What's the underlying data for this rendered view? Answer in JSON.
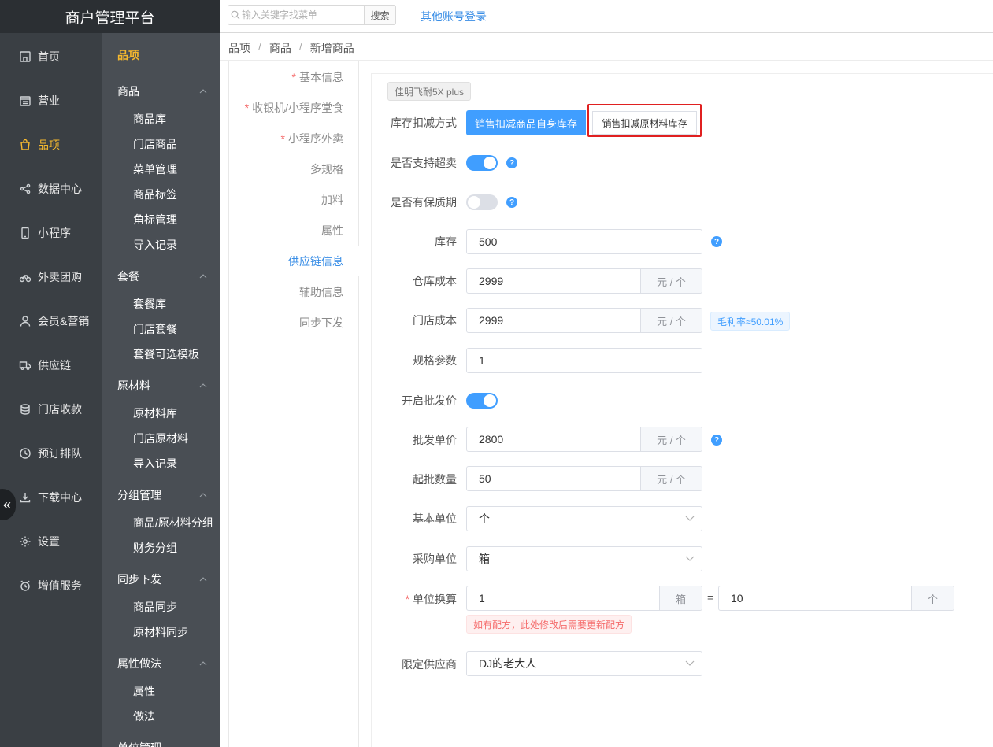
{
  "app": {
    "brand": "商户管理平台"
  },
  "leftnav": {
    "items": [
      {
        "label": "首页",
        "icon": "home-icon",
        "active": false
      },
      {
        "label": "营业",
        "icon": "calendar-icon",
        "active": false
      },
      {
        "label": "品项",
        "icon": "bag-icon",
        "active": true
      },
      {
        "label": "数据中心",
        "icon": "share-icon",
        "active": false
      },
      {
        "label": "小程序",
        "icon": "phone-icon",
        "active": false
      },
      {
        "label": "外卖团购",
        "icon": "bike-icon",
        "active": false
      },
      {
        "label": "会员&营销",
        "icon": "user-icon",
        "active": false
      },
      {
        "label": "供应链",
        "icon": "truck-icon",
        "active": false
      },
      {
        "label": "门店收款",
        "icon": "coins-icon",
        "active": false
      },
      {
        "label": "预订排队",
        "icon": "clock-icon",
        "active": false
      },
      {
        "label": "下载中心",
        "icon": "download-icon",
        "active": false
      },
      {
        "label": "设置",
        "icon": "gear-icon",
        "active": false
      },
      {
        "label": "增值服务",
        "icon": "alarm-icon",
        "active": false
      }
    ],
    "collapse_glyph": "«"
  },
  "subnav": {
    "title": "品项",
    "groups": [
      {
        "label": "商品",
        "items": [
          "商品库",
          "门店商品",
          "菜单管理",
          "商品标签",
          "角标管理",
          "导入记录"
        ]
      },
      {
        "label": "套餐",
        "items": [
          "套餐库",
          "门店套餐",
          "套餐可选模板"
        ]
      },
      {
        "label": "原材料",
        "items": [
          "原材料库",
          "门店原材料",
          "导入记录"
        ]
      },
      {
        "label": "分组管理",
        "items": [
          "商品/原材料分组",
          "财务分组"
        ]
      },
      {
        "label": "同步下发",
        "items": [
          "商品同步",
          "原材料同步"
        ]
      },
      {
        "label": "属性做法",
        "items": [
          "属性",
          "做法"
        ]
      },
      {
        "label": "单位管理",
        "items": []
      }
    ]
  },
  "topbar": {
    "search_placeholder": "输入关键字找菜单",
    "search_button": "搜索",
    "other_login": "其他账号登录"
  },
  "breadcrumb": [
    "品项",
    "商品",
    "新增商品"
  ],
  "tabs": [
    {
      "label": "基本信息",
      "required": true
    },
    {
      "label": "收银机/小程序堂食",
      "required": true
    },
    {
      "label": "小程序外卖",
      "required": true
    },
    {
      "label": "多规格",
      "required": false
    },
    {
      "label": "加料",
      "required": false
    },
    {
      "label": "属性",
      "required": false
    },
    {
      "label": "供应链信息",
      "required": false,
      "active": true
    },
    {
      "label": "辅助信息",
      "required": false
    },
    {
      "label": "同步下发",
      "required": false
    }
  ],
  "form": {
    "product_tag": "佳明飞耐5X plus",
    "stock_deduct": {
      "label": "库存扣减方式",
      "option_selected": "销售扣减商品自身库存",
      "option_other": "销售扣减原材料库存"
    },
    "oversell": {
      "label": "是否支持超卖",
      "on": true
    },
    "shelf_life": {
      "label": "是否有保质期",
      "on": false
    },
    "stock": {
      "label": "库存",
      "value": "500"
    },
    "warehouse_cost": {
      "label": "仓库成本",
      "value": "2999",
      "unit": "元 / 个"
    },
    "store_cost": {
      "label": "门店成本",
      "value": "2999",
      "unit": "元 / 个",
      "margin": "毛利率≈50.01%"
    },
    "spec_param": {
      "label": "规格参数",
      "value": "1"
    },
    "wholesale": {
      "label": "开启批发价",
      "on": true
    },
    "wholesale_price": {
      "label": "批发单价",
      "value": "2800",
      "unit": "元 / 个"
    },
    "min_qty": {
      "label": "起批数量",
      "value": "50",
      "unit": "元 / 个"
    },
    "base_unit": {
      "label": "基本单位",
      "value": "个"
    },
    "purchase_unit": {
      "label": "采购单位",
      "value": "箱"
    },
    "unit_conv": {
      "label": "单位换算",
      "left_value": "1",
      "left_unit": "箱",
      "equals": "=",
      "right_value": "10",
      "right_unit": "个",
      "warning": "如有配方，此处修改后需要更新配方"
    },
    "supplier": {
      "label": "限定供应商",
      "value": "DJ的老大人"
    },
    "help_glyph": "?"
  }
}
